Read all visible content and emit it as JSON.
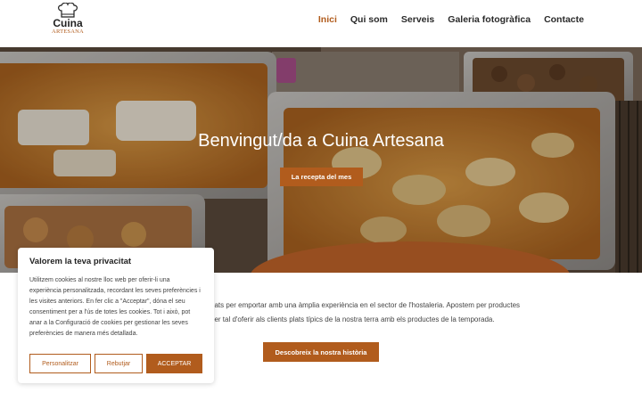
{
  "header": {
    "logo": {
      "line1": "Cuina",
      "line2": "ARTESANA"
    },
    "nav": [
      {
        "label": "Inici",
        "active": true
      },
      {
        "label": "Qui som",
        "active": false
      },
      {
        "label": "Serveis",
        "active": false
      },
      {
        "label": "Galeria fotogràfica",
        "active": false
      },
      {
        "label": "Contacte",
        "active": false
      }
    ]
  },
  "hero": {
    "title": "Benvingut/da a Cuina Artesana",
    "button": "La recepta del mes"
  },
  "intro": {
    "line1": "nats per emportar amb una àmplia experiència en el sector de l'hostaleria. Apostem per productes",
    "line2": "per tal d'oferir als clients plats típics de la nostra terra amb els productes de la temporada.",
    "button": "Descobreix la nostra història"
  },
  "cookie": {
    "title": "Valorem la teva privacitat",
    "text": "Utilitzem cookies al nostre lloc web per oferir-li una experiència personalitzada, recordant les seves preferències i les visites anteriors. En fer clic a \"Acceptar\", dóna el seu consentiment per a l'ús de totes les cookies. Tot i això, pot anar a la Configuració de cookies per gestionar les seves preferències de manera més detallada.",
    "customize": "Personalitzar",
    "reject": "Rebutjar",
    "accept": "ACCEPTAR"
  },
  "colors": {
    "accent": "#b15c1d"
  }
}
